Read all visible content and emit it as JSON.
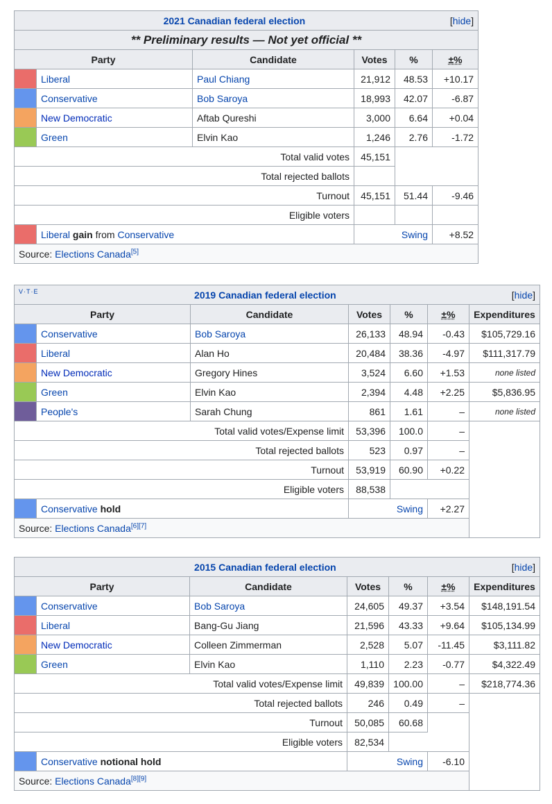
{
  "colors": {
    "liberal": "#ea6d6a",
    "conservative": "#6495ed",
    "ndp": "#f4a460",
    "green": "#99c955",
    "peoples": "#6f5d9a"
  },
  "e2021": {
    "title": "2021 Canadian federal election",
    "hide": "hide",
    "prelim": "** Preliminary results — Not yet official **",
    "headers": {
      "party": "Party",
      "candidate": "Candidate",
      "votes": "Votes",
      "pct": "%",
      "change": "±%"
    },
    "rows": [
      {
        "party": "Liberal",
        "candidate": "Paul Chiang",
        "votes": "21,912",
        "pct": "48.53",
        "change": "+10.17"
      },
      {
        "party": "Conservative",
        "candidate": "Bob Saroya",
        "votes": "18,993",
        "pct": "42.07",
        "change": "-6.87"
      },
      {
        "party": "New Democratic",
        "candidate": "Aftab Qureshi",
        "votes": "3,000",
        "pct": "6.64",
        "change": "+0.04"
      },
      {
        "party": "Green",
        "candidate": "Elvin Kao",
        "votes": "1,246",
        "pct": "2.76",
        "change": "-1.72"
      }
    ],
    "total_valid": {
      "label": "Total valid votes",
      "votes": "45,151"
    },
    "rejected": {
      "label": "Total rejected ballots"
    },
    "turnout": {
      "label": "Turnout",
      "votes": "45,151",
      "pct": "51.44",
      "change": "-9.46"
    },
    "eligible": {
      "label": "Eligible voters"
    },
    "result": {
      "winner": "Liberal",
      "word": "gain",
      "from": "from",
      "loser": "Conservative",
      "swing_label": "Swing",
      "swing": "+8.52"
    },
    "source": {
      "label": "Source:",
      "link": "Elections Canada",
      "ref": "[5]"
    }
  },
  "e2019": {
    "vte": "V·T·E",
    "title": "2019 Canadian federal election",
    "hide": "hide",
    "headers": {
      "party": "Party",
      "candidate": "Candidate",
      "votes": "Votes",
      "pct": "%",
      "change": "±%",
      "exp": "Expenditures"
    },
    "rows": [
      {
        "party": "Conservative",
        "candidate": "Bob Saroya",
        "votes": "26,133",
        "pct": "48.94",
        "change": "-0.43",
        "exp": "$105,729.16"
      },
      {
        "party": "Liberal",
        "candidate": "Alan Ho",
        "votes": "20,484",
        "pct": "38.36",
        "change": "-4.97",
        "exp": "$111,317.79"
      },
      {
        "party": "New Democratic",
        "candidate": "Gregory Hines",
        "votes": "3,524",
        "pct": "6.60",
        "change": "+1.53",
        "exp": "none listed"
      },
      {
        "party": "Green",
        "candidate": "Elvin Kao",
        "votes": "2,394",
        "pct": "4.48",
        "change": "+2.25",
        "exp": "$5,836.95"
      },
      {
        "party": "People's",
        "candidate": "Sarah Chung",
        "votes": "861",
        "pct": "1.61",
        "change": "–",
        "exp": "none listed"
      }
    ],
    "total_valid": {
      "label": "Total valid votes/Expense limit",
      "votes": "53,396",
      "pct": "100.0",
      "change": "–"
    },
    "rejected": {
      "label": "Total rejected ballots",
      "votes": "523",
      "pct": "0.97",
      "change": "–"
    },
    "turnout": {
      "label": "Turnout",
      "votes": "53,919",
      "pct": "60.90",
      "change": "+0.22"
    },
    "eligible": {
      "label": "Eligible voters",
      "votes": "88,538"
    },
    "result": {
      "winner": "Conservative",
      "word": "hold",
      "swing_label": "Swing",
      "swing": "+2.27"
    },
    "source": {
      "label": "Source:",
      "link": "Elections Canada",
      "ref": "[6][7]"
    }
  },
  "e2015": {
    "title": "2015 Canadian federal election",
    "hide": "hide",
    "headers": {
      "party": "Party",
      "candidate": "Candidate",
      "votes": "Votes",
      "pct": "%",
      "change": "±%",
      "exp": "Expenditures"
    },
    "rows": [
      {
        "party": "Conservative",
        "candidate": "Bob Saroya",
        "votes": "24,605",
        "pct": "49.37",
        "change": "+3.54",
        "exp": "$148,191.54"
      },
      {
        "party": "Liberal",
        "candidate": "Bang-Gu Jiang",
        "votes": "21,596",
        "pct": "43.33",
        "change": "+9.64",
        "exp": "$105,134.99"
      },
      {
        "party": "New Democratic",
        "candidate": "Colleen Zimmerman",
        "votes": "2,528",
        "pct": "5.07",
        "change": "-11.45",
        "exp": "$3,111.82"
      },
      {
        "party": "Green",
        "candidate": "Elvin Kao",
        "votes": "1,110",
        "pct": "2.23",
        "change": "-0.77",
        "exp": "$4,322.49"
      }
    ],
    "total_valid": {
      "label": "Total valid votes/Expense limit",
      "votes": "49,839",
      "pct": "100.00",
      "change": "–",
      "exp": "$218,774.36"
    },
    "rejected": {
      "label": "Total rejected ballots",
      "votes": "246",
      "pct": "0.49",
      "change": "–"
    },
    "turnout": {
      "label": "Turnout",
      "votes": "50,085",
      "pct": "60.68"
    },
    "eligible": {
      "label": "Eligible voters",
      "votes": "82,534"
    },
    "result": {
      "winner": "Conservative",
      "word": "notional hold",
      "swing_label": "Swing",
      "swing": "-6.10"
    },
    "source": {
      "label": "Source:",
      "link": "Elections Canada",
      "ref": "[8][9]"
    }
  }
}
